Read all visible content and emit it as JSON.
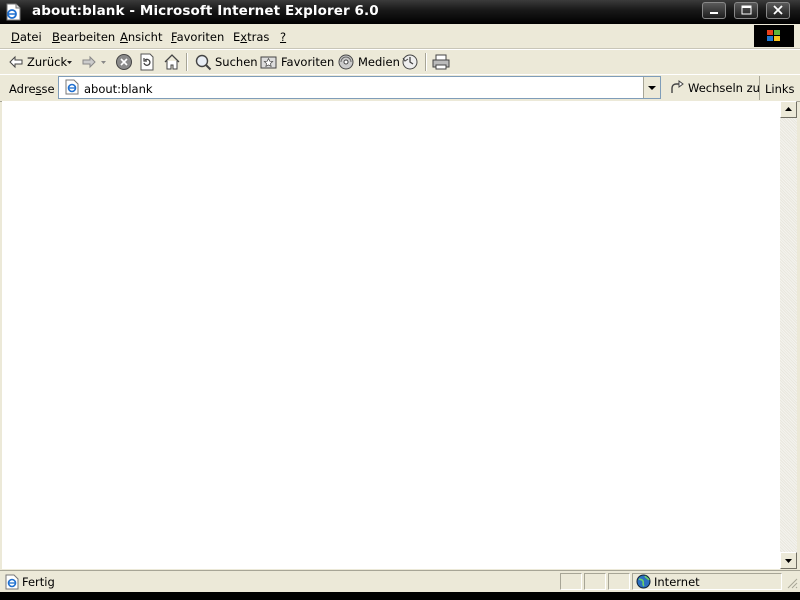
{
  "window": {
    "title": "about:blank - Microsoft Internet Explorer 6.0"
  },
  "menu": {
    "items": [
      {
        "pre": "",
        "ul": "D",
        "post": "atei"
      },
      {
        "pre": "",
        "ul": "B",
        "post": "earbeiten"
      },
      {
        "pre": "",
        "ul": "A",
        "post": "nsicht"
      },
      {
        "pre": "",
        "ul": "F",
        "post": "avoriten"
      },
      {
        "pre": "E",
        "ul": "x",
        "post": "tras"
      },
      {
        "pre": "",
        "ul": "?",
        "post": ""
      }
    ]
  },
  "toolbar": {
    "back_label": "Zurück",
    "search_label": "Suchen",
    "favorites_label": "Favoriten",
    "media_label": "Medien"
  },
  "address": {
    "label_pre": "Adre",
    "label_ul": "s",
    "label_post": "se",
    "value": "about:blank",
    "go_label": "Wechseln zu",
    "links_label": "Links"
  },
  "status": {
    "text": "Fertig",
    "zone": "Internet"
  },
  "colors": {
    "chrome": "#ece9d8",
    "titlebar": "#000000",
    "content": "#ffffff"
  },
  "icons": [
    "ie-page-icon",
    "minimize-icon",
    "maximize-icon",
    "close-icon",
    "windows-logo-icon",
    "back-arrow-icon",
    "forward-arrow-icon",
    "stop-icon",
    "refresh-icon",
    "home-icon",
    "search-icon",
    "favorites-icon",
    "media-icon",
    "history-icon",
    "print-icon",
    "go-arrow-icon",
    "globe-icon"
  ]
}
